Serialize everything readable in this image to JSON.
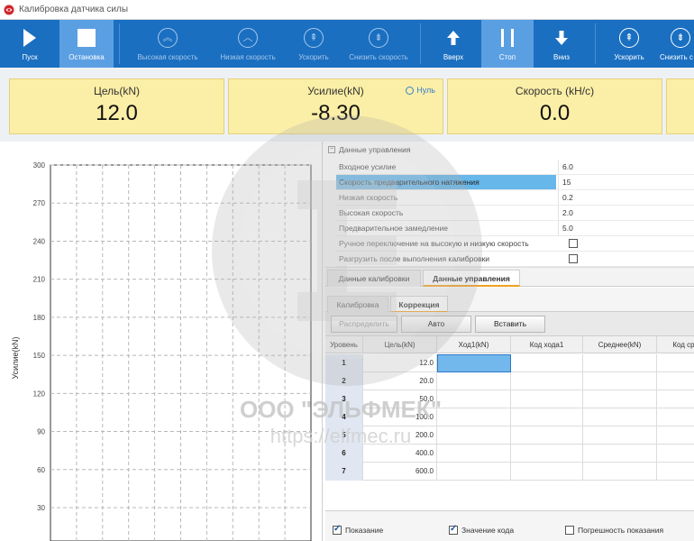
{
  "window": {
    "title": "Калибровка датчика силы"
  },
  "toolbar": {
    "start": "Пуск",
    "stop_motion": "Остановка",
    "high_speed": "Высокая скорость",
    "low_speed": "Низкая скорость",
    "accelerate": "Ускорить",
    "decelerate": "Снизить скорость",
    "up": "Вверх",
    "stop": "Стоп",
    "down": "Вниз",
    "accelerate2": "Ускорить",
    "decelerate2": "Снизить с"
  },
  "cards": {
    "target": {
      "title": "Цель(kN)",
      "value": "12.0"
    },
    "force": {
      "title": "Усилие(kN)",
      "value": "-8.30",
      "zero_label": "Нуль"
    },
    "speed": {
      "title": "Скорость (kH/c)",
      "value": "0.0"
    }
  },
  "chart_data": {
    "type": "line",
    "ylabel": "Усилие(kN)",
    "yticks": [
      30,
      60,
      90,
      120,
      150,
      180,
      210,
      240,
      270,
      300
    ],
    "ylim": [
      0,
      300
    ],
    "series": [],
    "grid": true
  },
  "control": {
    "header": "Данные управления",
    "rows": [
      {
        "name": "Входное усилие",
        "value": "6.0",
        "type": "text"
      },
      {
        "name": "Скорость предварительного натяжения",
        "value": "15",
        "type": "text",
        "selected": true
      },
      {
        "name": "Низкая скорость",
        "value": "0.2",
        "type": "text"
      },
      {
        "name": "Высокая скорость",
        "value": "2.0",
        "type": "text"
      },
      {
        "name": "Предварительное замедление",
        "value": "5.0",
        "type": "text"
      },
      {
        "name": "Ручное переключение на высокую и низкую скорость",
        "value": "",
        "type": "checkbox"
      },
      {
        "name": "Разгрузить после выполнения калибровки",
        "value": "",
        "type": "checkbox"
      }
    ]
  },
  "tabs_main": [
    "Данные калибровки",
    "Данные управления"
  ],
  "tabs_sub": [
    "Калибровка",
    "Коррекция"
  ],
  "buttons": {
    "distribute": "Распределить",
    "auto": "Авто",
    "insert": "Вставить"
  },
  "grid": {
    "headers": [
      "Уровень",
      "Цель(kN)",
      "Ход1(kN)",
      "Код хода1",
      "Среднее(kN)",
      "Код ср"
    ],
    "rows": [
      {
        "level": "1",
        "target": "12.0"
      },
      {
        "level": "2",
        "target": "20.0"
      },
      {
        "level": "3",
        "target": "50.0"
      },
      {
        "level": "4",
        "target": "100.0"
      },
      {
        "level": "5",
        "target": "200.0"
      },
      {
        "level": "6",
        "target": "400.0"
      },
      {
        "level": "7",
        "target": "600.0"
      }
    ]
  },
  "bottom": {
    "show_reading": "Показание",
    "code_value": "Значение кода",
    "reading_error": "Погрешность показания"
  },
  "watermark": {
    "text": "ООО \"ЭЛЬФМЕК\"",
    "url": "https://elfmec.ru"
  },
  "colors": {
    "toolbar": "#1a6fc1",
    "active_button": "#5b9fe3",
    "card": "#fbeea6",
    "selection": "#67b7ea"
  }
}
